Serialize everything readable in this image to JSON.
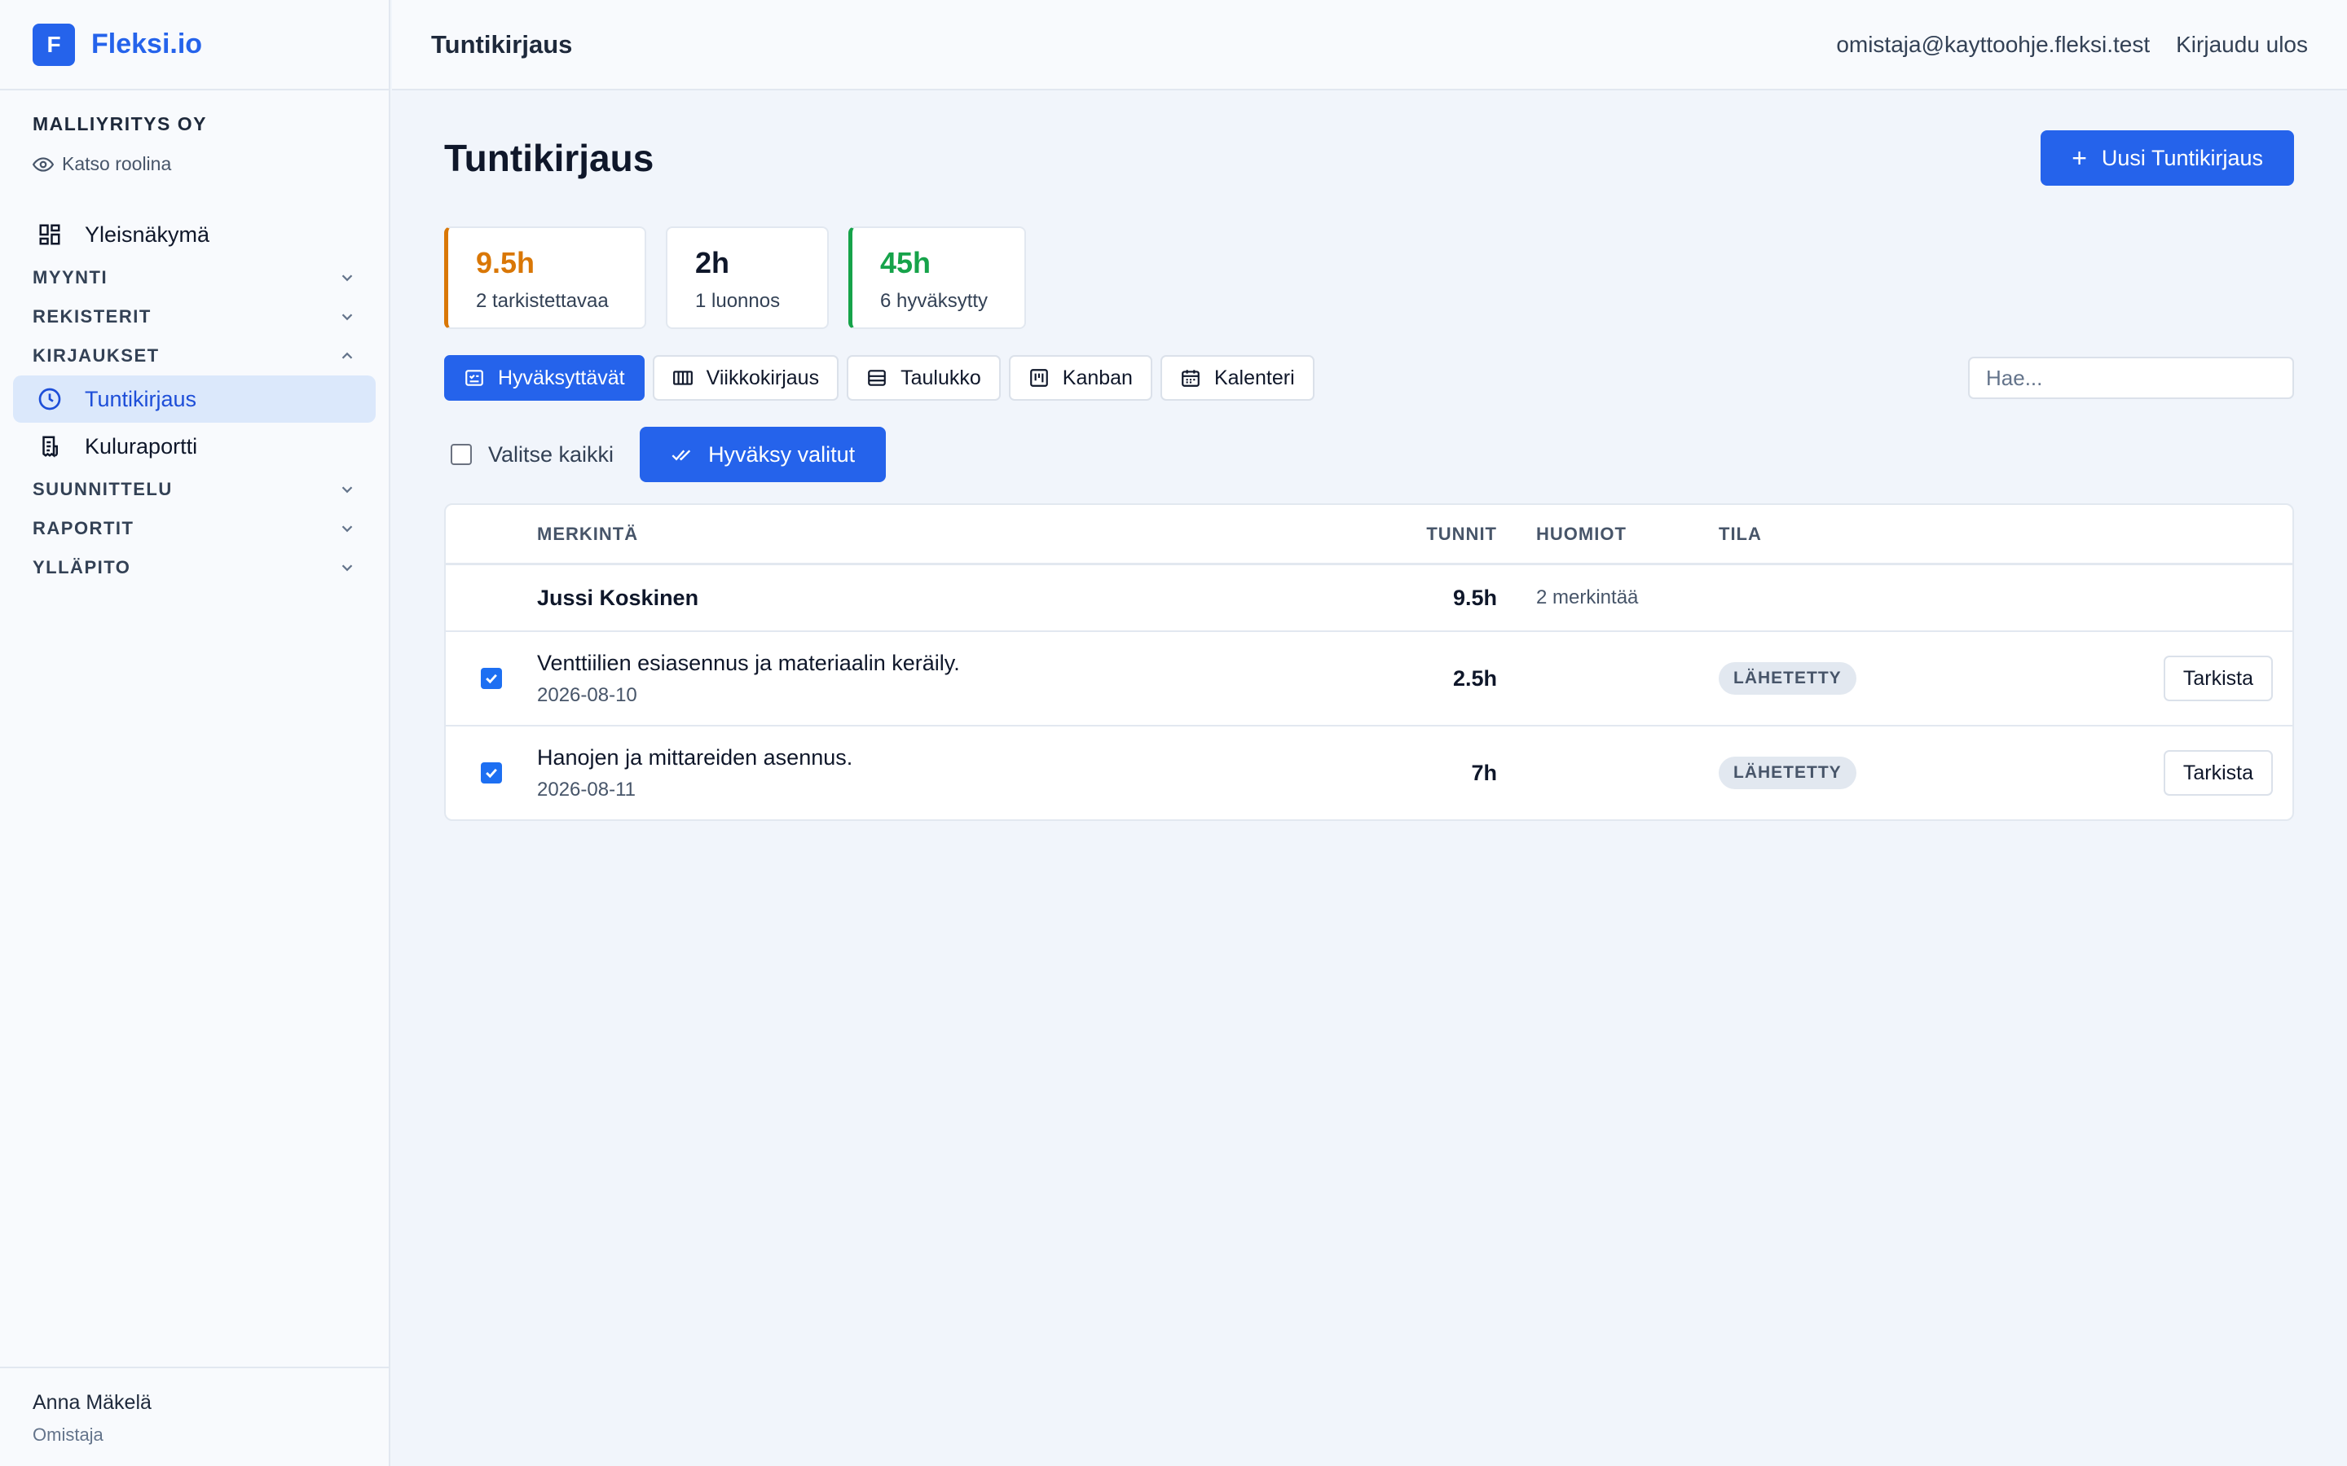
{
  "brand": {
    "logo_letter": "F",
    "name": "Fleksi.io",
    "color": "#2563eb"
  },
  "sidebar": {
    "company": "MALLIYRITYS OY",
    "view_as_role": "Katso roolina",
    "overview": {
      "label": "Yleisnäkymä",
      "icon": "dashboard-icon"
    },
    "sections": {
      "myynti": "MYYNTI",
      "rekisterit": "REKISTERIT",
      "kirjaukset": "KIRJAUKSET",
      "suunnittelu": "SUUNNITTELU",
      "raportit": "RAPORTIT",
      "yllapito": "YLLÄPITO"
    },
    "kirjaukset_items": [
      {
        "label": "Tuntikirjaus",
        "icon": "clock-icon",
        "active": true
      },
      {
        "label": "Kuluraportti",
        "icon": "receipt-icon",
        "active": false
      }
    ],
    "user": {
      "name": "Anna Mäkelä",
      "role": "Omistaja"
    }
  },
  "header": {
    "title": "Tuntikirjaus",
    "email": "omistaja@kayttoohje.fleksi.test",
    "logout": "Kirjaudu ulos"
  },
  "main": {
    "title": "Tuntikirjaus",
    "new_button": "Uusi Tuntikirjaus",
    "stats": [
      {
        "value": "9.5h",
        "label": "2 tarkistettavaa",
        "color": "#d97706"
      },
      {
        "value": "2h",
        "label": "1 luonnos",
        "color": "#0f172a"
      },
      {
        "value": "45h",
        "label": "6 hyväksytty",
        "color": "#16a34a"
      }
    ],
    "views": [
      {
        "label": "Hyväksyttävät",
        "icon": "approval-list-icon",
        "active": true
      },
      {
        "label": "Viikkokirjaus",
        "icon": "week-grid-icon",
        "active": false
      },
      {
        "label": "Taulukko",
        "icon": "table-icon",
        "active": false
      },
      {
        "label": "Kanban",
        "icon": "kanban-icon",
        "active": false
      },
      {
        "label": "Kalenteri",
        "icon": "calendar-icon",
        "active": false
      }
    ],
    "search_placeholder": "Hae...",
    "select_all": "Valitse kaikki",
    "approve_selected": "Hyväksy valitut",
    "table": {
      "columns": {
        "entry": "MERKINTÄ",
        "hours": "TUNNIT",
        "notes": "HUOMIOT",
        "state": "TILA"
      },
      "group": {
        "name": "Jussi Koskinen",
        "hours": "9.5h",
        "notes": "2 merkintää"
      },
      "rows": [
        {
          "description": "Venttiilien esiasennus ja materiaalin keräily.",
          "date": "2026-08-10",
          "hours": "2.5h",
          "state": "LÄHETETTY",
          "action": "Tarkista",
          "checked": true
        },
        {
          "description": "Hanojen ja mittareiden asennus.",
          "date": "2026-08-11",
          "hours": "7h",
          "state": "LÄHETETTY",
          "action": "Tarkista",
          "checked": true
        }
      ]
    }
  }
}
